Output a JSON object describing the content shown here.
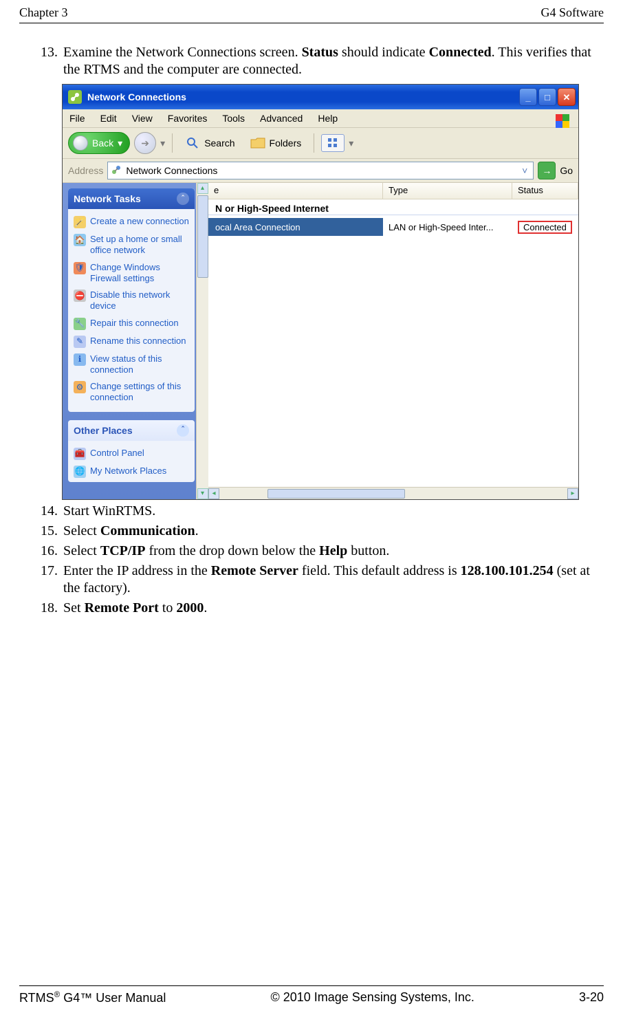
{
  "header": {
    "left": "Chapter 3",
    "right": "G4 Software"
  },
  "steps": {
    "s13_num": "13.",
    "s13_a": "Examine the Network Connections screen. ",
    "s13_b1": "Status",
    "s13_c": " should indicate ",
    "s13_b2": "Connected",
    "s13_d": ". This verifies that the RTMS and the computer are connected.",
    "s14_num": "14.",
    "s14": "Start WinRTMS.",
    "s15_num": "15.",
    "s15_a": "Select ",
    "s15_b": "Communication",
    "s15_c": ".",
    "s16_num": "16.",
    "s16_a": "Select ",
    "s16_b": "TCP/IP",
    "s16_c": " from the drop down below the ",
    "s16_d": "Help",
    "s16_e": " button.",
    "s17_num": "17.",
    "s17_a": "Enter the IP address in the ",
    "s17_b": "Remote Server",
    "s17_c": " field. This default address is ",
    "s17_d": "128.100.101.254",
    "s17_e": " (set at the factory).",
    "s18_num": "18.",
    "s18_a": "Set ",
    "s18_b": "Remote Port",
    "s18_c": " to ",
    "s18_d": "2000",
    "s18_e": "."
  },
  "win": {
    "title": "Network Connections",
    "menu": {
      "file": "File",
      "edit": "Edit",
      "view": "View",
      "favorites": "Favorites",
      "tools": "Tools",
      "advanced": "Advanced",
      "help": "Help"
    },
    "tb": {
      "back": "Back",
      "search": "Search",
      "folders": "Folders"
    },
    "addr": {
      "label": "Address",
      "value": "Network Connections",
      "go": "Go"
    },
    "cols": {
      "name": "e",
      "type": "Type",
      "status": "Status"
    },
    "group": "N or High-Speed Internet",
    "row": {
      "name": "ocal Area Connection",
      "type": "LAN or High-Speed Inter...",
      "status": "Connected"
    },
    "tasks": {
      "hd1": "Network Tasks",
      "t1": "Create a new connection",
      "t2": "Set up a home or small office network",
      "t3": "Change Windows Firewall settings",
      "t4": "Disable this network device",
      "t5": "Repair this connection",
      "t6": "Rename this connection",
      "t7": "View status of this connection",
      "t8": "Change settings of this connection",
      "hd2": "Other Places",
      "p1": "Control Panel",
      "p2": "My Network Places"
    }
  },
  "footer": {
    "left_a": "RTMS",
    "left_sup": "®",
    "left_b": " G4™ User Manual",
    "center": "© 2010 Image Sensing Systems, Inc.",
    "right": "3-20"
  }
}
